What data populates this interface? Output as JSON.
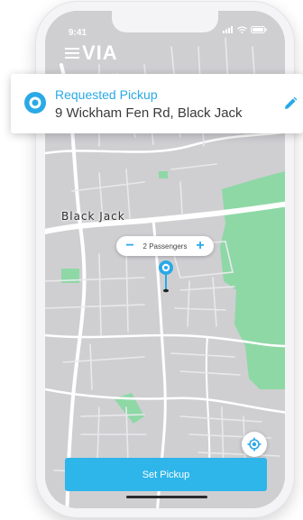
{
  "status_bar": {
    "time": "9:41"
  },
  "header": {
    "logo_text": "VIA"
  },
  "pickup_card": {
    "title": "Requested Pickup",
    "address": "9 Wickham Fen Rd, Black Jack"
  },
  "map": {
    "place_label": "Black Jack"
  },
  "passengers": {
    "label": "2 Passengers",
    "decrement": "−",
    "increment": "+"
  },
  "actions": {
    "set_pickup_label": "Set Pickup"
  },
  "colors": {
    "accent": "#2aa9e6",
    "button": "#2eb5ea",
    "park": "#8ed8a6",
    "map_bg": "#cfcfd2"
  },
  "icons": {
    "menu": "hamburger-menu-icon",
    "pickup": "pickup-pin-icon",
    "edit": "pencil-icon",
    "locate": "crosshair-icon",
    "pin": "map-pin-icon"
  }
}
